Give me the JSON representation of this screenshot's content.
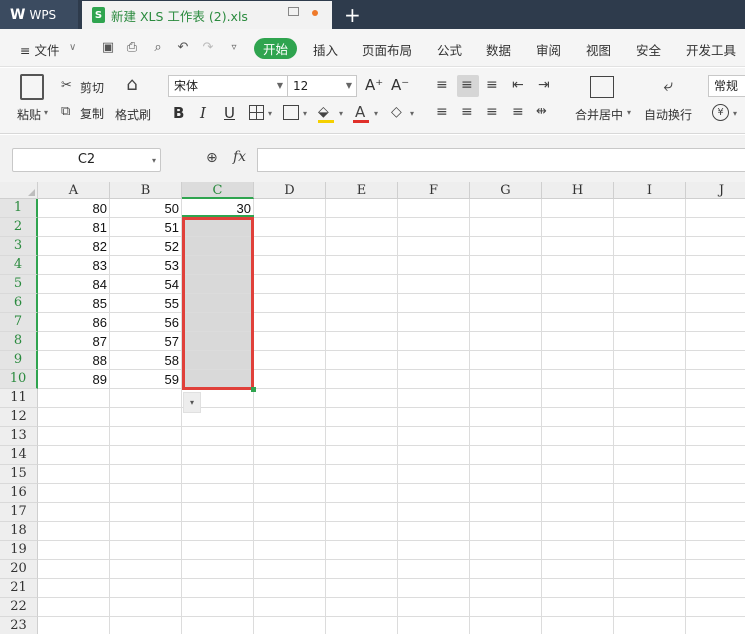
{
  "titlebar": {
    "app_tab": "WPS",
    "doc_tab": "新建 XLS 工作表 (2).xls",
    "doc_icon": "S",
    "new_tab": "+"
  },
  "menubar": {
    "file": "≡ 文件",
    "items": [
      "开始",
      "插入",
      "页面布局",
      "公式",
      "数据",
      "审阅",
      "视图",
      "安全",
      "开发工具"
    ]
  },
  "ribbon": {
    "paste": "粘贴",
    "cut": "剪切",
    "copy": "复制",
    "format_painter": "格式刷",
    "font_name": "宋体",
    "font_size": "12",
    "bold": "B",
    "italic": "I",
    "underline": "U",
    "merge_center": "合并居中",
    "wrap_text": "自动换行",
    "number_format": "常规",
    "font_grow": "A⁺",
    "font_shrink": "A⁻"
  },
  "formula_bar": {
    "name_box": "C2",
    "fx": "fx",
    "formula": ""
  },
  "sheet": {
    "columns": [
      "A",
      "B",
      "C",
      "D",
      "E",
      "F",
      "G",
      "H",
      "I",
      "J"
    ],
    "rows": [
      "1",
      "2",
      "3",
      "4",
      "5",
      "6",
      "7",
      "8",
      "9",
      "10",
      "11",
      "12",
      "13",
      "14",
      "15",
      "16",
      "17",
      "18",
      "19",
      "20",
      "21",
      "22",
      "23"
    ],
    "values": {
      "A": [
        "80",
        "81",
        "82",
        "83",
        "84",
        "85",
        "86",
        "87",
        "88",
        "89"
      ],
      "B": [
        "50",
        "51",
        "52",
        "53",
        "54",
        "55",
        "56",
        "57",
        "58",
        "59"
      ],
      "C1": "30"
    }
  },
  "colors": {
    "accent": "#2fa44f",
    "selection_border": "#e0403a",
    "titlebar": "#2e3b4c"
  }
}
